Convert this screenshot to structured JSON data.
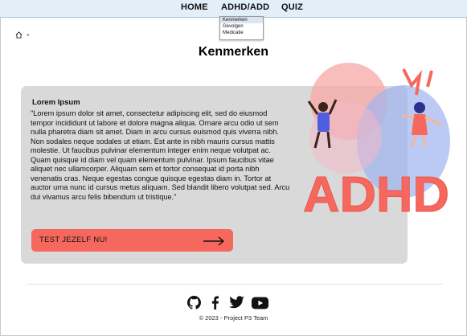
{
  "nav": {
    "home": "HOME",
    "adhd": "ADHD/ADD",
    "quiz": "QUIZ",
    "dropdown": [
      "Kenmerken",
      "Gevolgen",
      "Medicatie"
    ]
  },
  "breadcrumb": {
    "separator": "«"
  },
  "page": {
    "title": "Kenmerken"
  },
  "card": {
    "heading": "Lorem Ipsum",
    "body": "\"Lorem ipsum dolor sit amet, consectetur adipiscing elit, sed do eiusmod tempor incididunt ut labore et dolore magna aliqua. Ornare arcu odio ut sem nulla pharetra diam sit amet. Diam in arcu cursus euismod quis viverra nibh. Non sodales neque sodales ut etiam. Est ante in nibh mauris cursus mattis molestie. Ut faucibus pulvinar elementum integer enim neque volutpat ac. Quam quisque id diam vel quam elementum pulvinar. Ipsum faucibus vitae aliquet nec ullamcorper. Aliquam sem et tortor consequat id porta nibh venenatis cras. Neque egestas congue quisque egestas diam in. Tortor at auctor urna nunc id cursus metus aliquam. Sed blandit libero volutpat sed. Arcu dui vivamus arcu felis bibendum ut tristique.\"",
    "cta_label": "TEST JEZELF NU!"
  },
  "illustration": {
    "text": "ADHD"
  },
  "footer": {
    "icons": [
      "github-icon",
      "facebook-icon",
      "twitter-icon",
      "youtube-icon"
    ],
    "copyright": "© 2023 - Project P3 Team"
  },
  "colors": {
    "accent": "#f6685e",
    "card": "#d9d9d9",
    "nav": "#e2eef8"
  }
}
